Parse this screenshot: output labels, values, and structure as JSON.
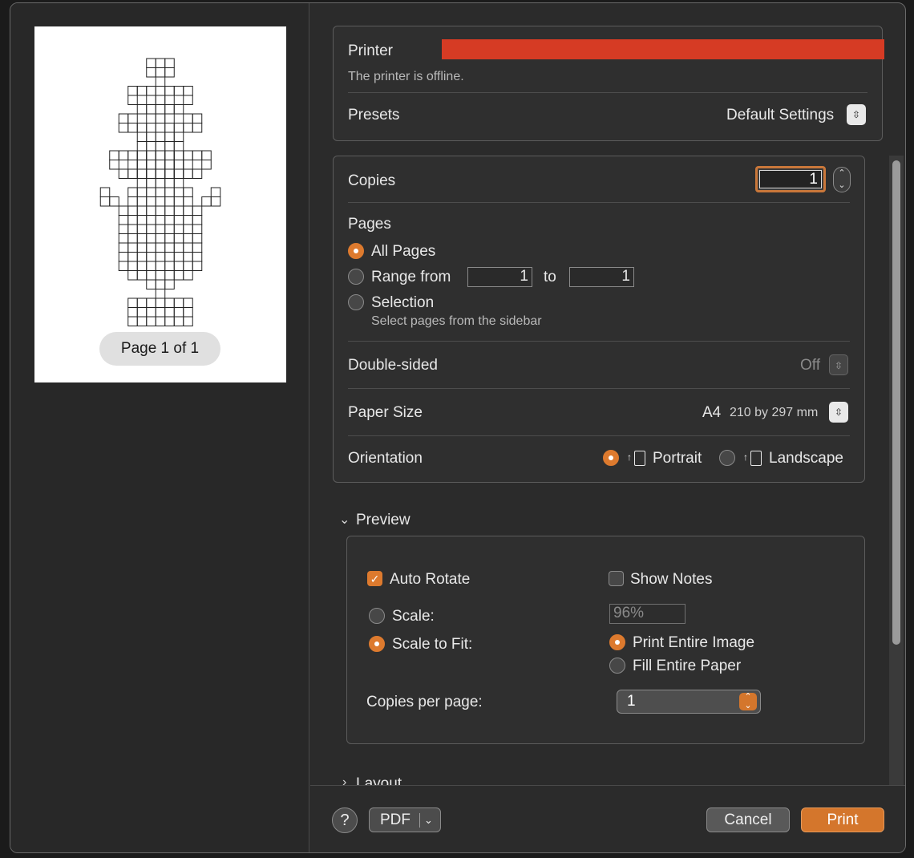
{
  "sidebar": {
    "page_badge": "Page 1 of 1"
  },
  "printer": {
    "label": "Printer",
    "status": "The printer is offline.",
    "redaction_color": "#d63b24"
  },
  "presets": {
    "label": "Presets",
    "value": "Default Settings"
  },
  "copies": {
    "label": "Copies",
    "value": "1"
  },
  "pages": {
    "label": "Pages",
    "all_pages": "All Pages",
    "range_from": "Range from",
    "range_from_value": "1",
    "to": "to",
    "range_to_value": "1",
    "selection": "Selection",
    "selection_hint": "Select pages from the sidebar",
    "selected": "All Pages"
  },
  "double_sided": {
    "label": "Double-sided",
    "value": "Off"
  },
  "paper_size": {
    "label": "Paper Size",
    "value": "A4",
    "dimensions": "210 by 297 mm"
  },
  "orientation": {
    "label": "Orientation",
    "portrait": "Portrait",
    "landscape": "Landscape",
    "selected": "Portrait"
  },
  "preview": {
    "header": "Preview",
    "auto_rotate": "Auto Rotate",
    "auto_rotate_checked": true,
    "show_notes": "Show Notes",
    "show_notes_checked": false,
    "scale": "Scale:",
    "scale_value": "96%",
    "scale_to_fit": "Scale to Fit:",
    "print_entire_image": "Print Entire Image",
    "fill_entire_paper": "Fill Entire Paper",
    "copies_per_page_label": "Copies per page:",
    "copies_per_page_value": "1"
  },
  "layout": {
    "header": "Layout"
  },
  "footer": {
    "help": "?",
    "pdf": "PDF",
    "cancel": "Cancel",
    "print": "Print"
  },
  "colors": {
    "accent": "#dd7a2e",
    "window_bg": "#2b2b2b"
  }
}
